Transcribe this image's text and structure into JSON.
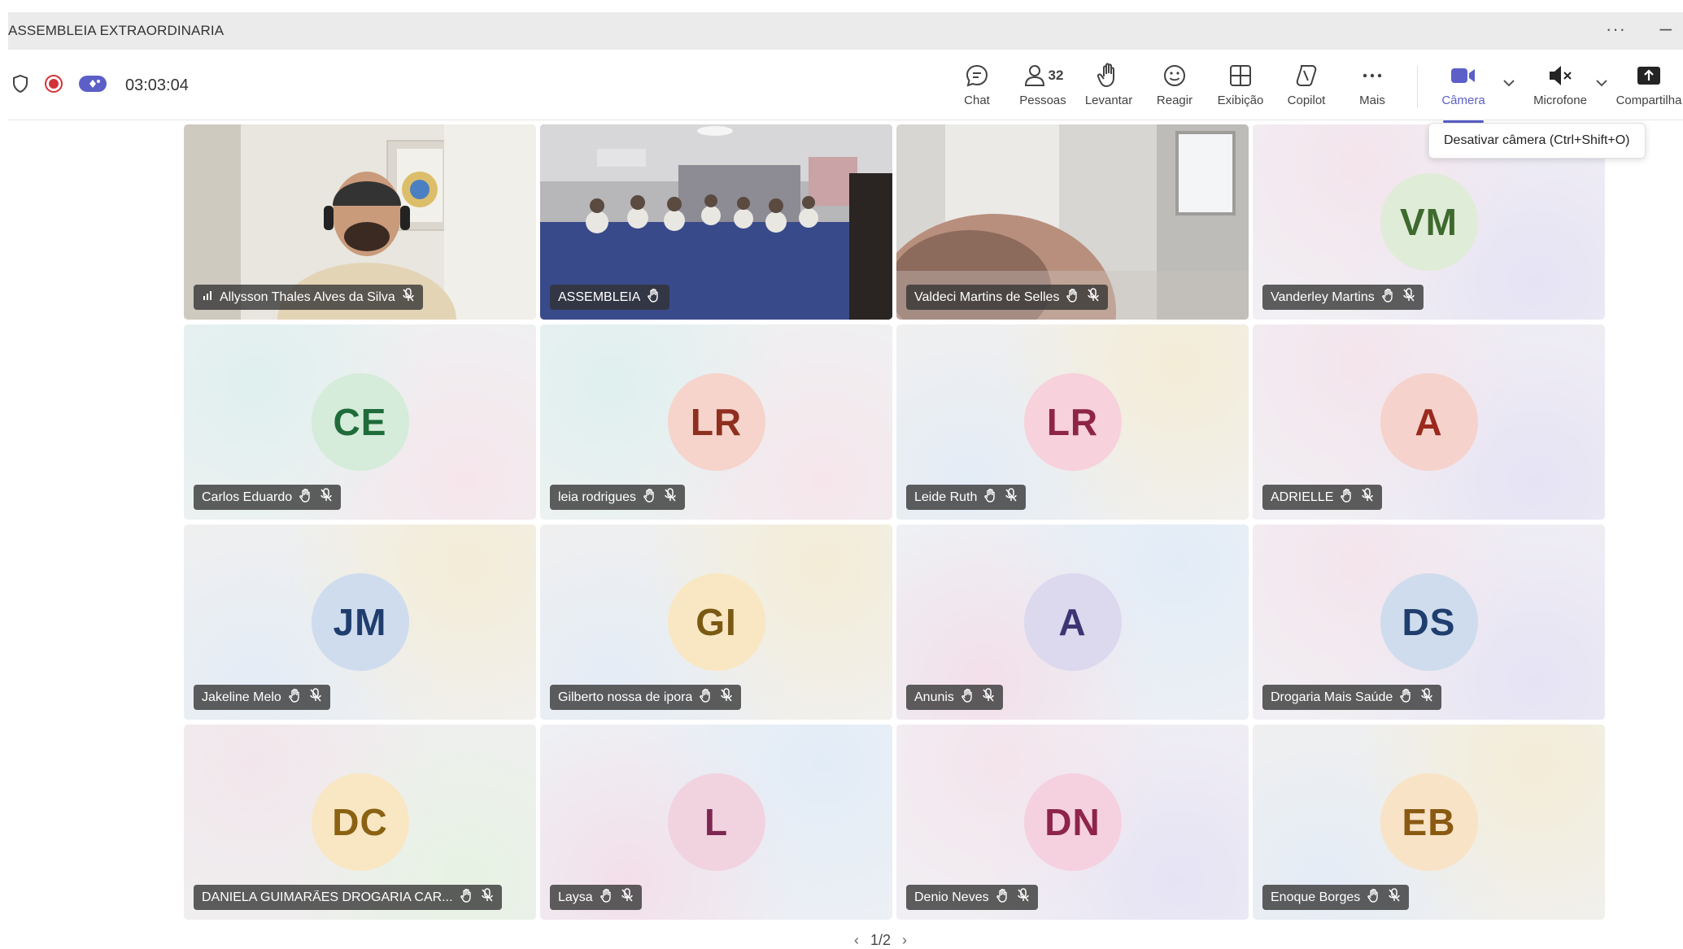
{
  "window": {
    "title": "ASSEMBLEIA EXTRAORDINARIA"
  },
  "meeting": {
    "timer": "03:03:04"
  },
  "toolbar": {
    "chat": "Chat",
    "people_count": "32",
    "people": "Pessoas",
    "raise": "Levantar",
    "react": "Reagir",
    "view": "Exibição",
    "copilot": "Copilot",
    "more": "Mais",
    "camera": "Câmera",
    "mic": "Microfone",
    "share": "Compartilha"
  },
  "tooltip": "Desativar câmera (Ctrl+Shift+O)",
  "participants": [
    {
      "name": "Allysson Thales Alves da Silva",
      "type": "video-person",
      "muted": true
    },
    {
      "name": "ASSEMBLEIA",
      "type": "video-room",
      "active_speaker": true
    },
    {
      "name": "Valdeci Martins de Selles",
      "type": "video-head",
      "muted": true
    },
    {
      "name": "Vanderley Martins",
      "initials": "VM",
      "avatar_bg": "#dfecd7",
      "avatar_fg": "#3f6a2f",
      "muted": true
    },
    {
      "name": "Carlos Eduardo",
      "initials": "CE",
      "avatar_bg": "#d4ecd9",
      "avatar_fg": "#1f6b3a",
      "muted": true
    },
    {
      "name": "leia rodrigues",
      "initials": "LR",
      "avatar_bg": "#f6d4cb",
      "avatar_fg": "#8f2f1f",
      "muted": true
    },
    {
      "name": "Leide Ruth",
      "initials": "LR",
      "avatar_bg": "#f7d1dc",
      "avatar_fg": "#8e2548",
      "muted": true
    },
    {
      "name": "ADRIELLE",
      "initials": "A",
      "avatar_bg": "#f6d2cc",
      "avatar_fg": "#9a2a1e",
      "muted": true
    },
    {
      "name": "Jakeline Melo",
      "initials": "JM",
      "avatar_bg": "#cfdcee",
      "avatar_fg": "#1f3e6e",
      "muted": true
    },
    {
      "name": "Gilberto nossa de ipora",
      "initials": "GI",
      "avatar_bg": "#f9e7c4",
      "avatar_fg": "#7a5a12",
      "muted": true
    },
    {
      "name": "Anunis",
      "initials": "A",
      "avatar_bg": "#dcd8ee",
      "avatar_fg": "#3c3573",
      "muted": true
    },
    {
      "name": "Drogaria Mais Saúde",
      "initials": "DS",
      "avatar_bg": "#cfdcee",
      "avatar_fg": "#1f3e6e",
      "muted": true
    },
    {
      "name": "DANIELA GUIMARÃES DROGARIA CAR...",
      "initials": "DC",
      "avatar_bg": "#f9e7c4",
      "avatar_fg": "#8a6212",
      "muted": true
    },
    {
      "name": "Laysa",
      "initials": "L",
      "avatar_bg": "#f1d3e0",
      "avatar_fg": "#7e2752",
      "muted": true
    },
    {
      "name": "Denio Neves",
      "initials": "DN",
      "avatar_bg": "#f5d1e0",
      "avatar_fg": "#8e2548",
      "muted": true
    },
    {
      "name": "Enoque Borges",
      "initials": "EB",
      "avatar_bg": "#f8e3c7",
      "avatar_fg": "#8a5a12",
      "muted": true
    }
  ],
  "pager": {
    "text": "1/2"
  },
  "colors": {
    "accent": "#5b5fc7",
    "record": "#d13438",
    "nametag_bg": "#333333"
  }
}
